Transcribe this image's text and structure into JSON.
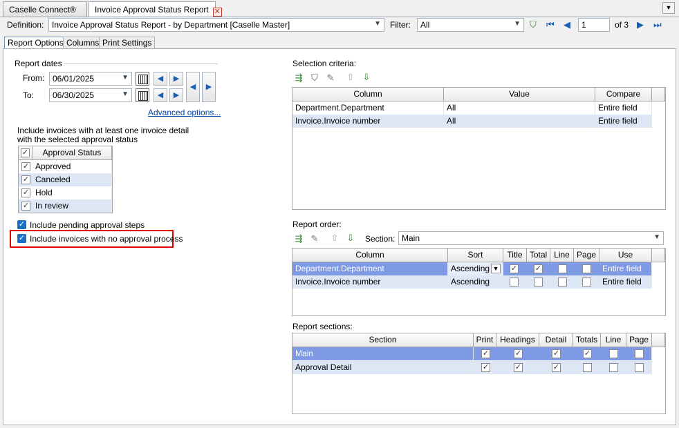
{
  "tabs": [
    {
      "label": "Caselle Connect®"
    },
    {
      "label": "Invoice Approval Status Report"
    }
  ],
  "definition": {
    "label": "Definition:",
    "value": "Invoice Approval Status Report - by Department [Caselle Master]",
    "filter_label": "Filter:",
    "filter_value": "All",
    "page_value": "1",
    "page_of": "of 3"
  },
  "option_tabs": [
    "Report Options",
    "Columns",
    "Print Settings"
  ],
  "report_dates": {
    "title": "Report dates",
    "from_label": "From:",
    "from_value": "06/01/2025",
    "to_label": "To:",
    "to_value": "06/30/2025",
    "advanced_link": "Advanced options..."
  },
  "include_text": {
    "line1": "Include invoices with at least one invoice detail",
    "line2": "with the selected approval status"
  },
  "approval_grid": {
    "header": "Approval Status",
    "rows": [
      {
        "label": "Approved",
        "checked": true
      },
      {
        "label": "Canceled",
        "checked": true
      },
      {
        "label": "Hold",
        "checked": true
      },
      {
        "label": "In review",
        "checked": true
      }
    ]
  },
  "checkboxes": {
    "pending": "Include pending approval steps",
    "no_process": "Include invoices with no approval process"
  },
  "selection": {
    "title": "Selection criteria:",
    "headers": [
      "Column",
      "Value",
      "Compare"
    ],
    "rows": [
      [
        "Department.Department",
        "All",
        "Entire field"
      ],
      [
        "Invoice.Invoice number",
        "All",
        "Entire field"
      ]
    ]
  },
  "order": {
    "title": "Report order:",
    "section_label": "Section:",
    "section_value": "Main",
    "headers": [
      "Column",
      "Sort",
      "Title",
      "Total",
      "Line",
      "Page",
      "Use"
    ],
    "rows": [
      {
        "column": "Department.Department",
        "sort": "Ascending",
        "title": true,
        "total": true,
        "line": false,
        "page": false,
        "use": "Entire field"
      },
      {
        "column": "Invoice.Invoice number",
        "sort": "Ascending",
        "title": false,
        "total": false,
        "line": false,
        "page": false,
        "use": "Entire field"
      }
    ]
  },
  "sections": {
    "title": "Report sections:",
    "headers": [
      "Section",
      "Print",
      "Headings",
      "Detail",
      "Totals",
      "Line",
      "Page"
    ],
    "rows": [
      {
        "section": "Main",
        "flags": [
          true,
          true,
          true,
          true,
          false,
          false
        ]
      },
      {
        "section": "Approval Detail",
        "flags": [
          true,
          true,
          true,
          false,
          false,
          false
        ]
      }
    ]
  },
  "colors": {
    "selected_row": "#7f9ae4",
    "alt_row": "#dce6f5",
    "highlight_box": "#e00000",
    "checkbox_blue": "#1a6fc4"
  }
}
